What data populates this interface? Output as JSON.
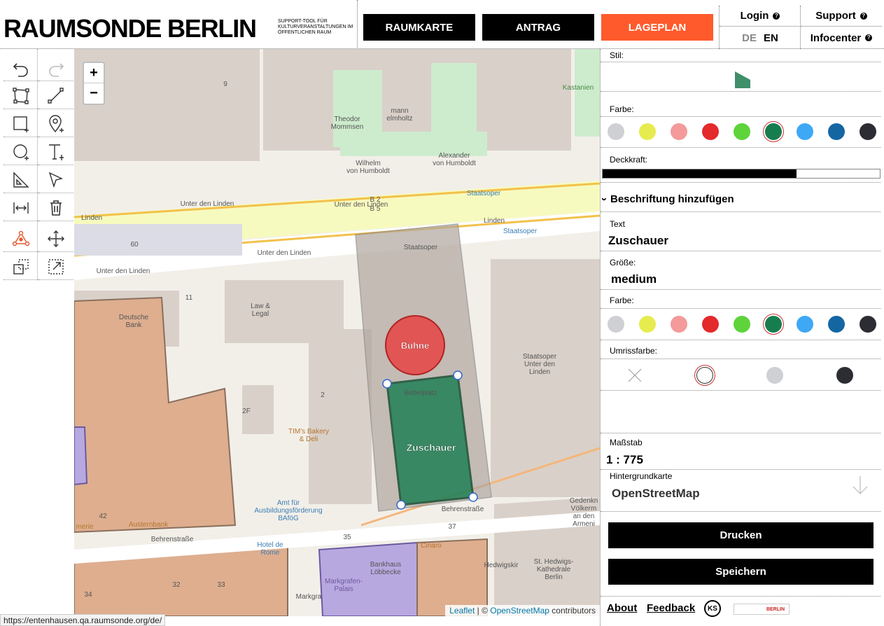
{
  "header": {
    "brand_title": "RAUMSONDE BERLIN",
    "brand_subtitle": "SUPPORT-TOOL FÜR KULTURVERANSTALTUNGEN IM ÖFFENTLICHEN RAUM",
    "nav": [
      {
        "label": "RAUMKARTE",
        "color": "#000000"
      },
      {
        "label": "ANTRAG",
        "color": "#000000"
      },
      {
        "label": "LAGEPLAN",
        "color": "#ff5a2c"
      }
    ],
    "login_label": "Login",
    "support_label": "Support",
    "lang_de": "DE",
    "lang_en": "EN",
    "infocenter_label": "Infocenter",
    "help_glyph": "?"
  },
  "toolbar": {
    "tools": [
      "undo-icon",
      "redo-icon",
      "polygon-icon",
      "line-icon",
      "rectangle-icon",
      "marker-icon",
      "circle-icon",
      "text-icon",
      "measure-icon",
      "select-icon",
      "dimension-icon",
      "trash-icon",
      "vertex-edit-icon",
      "move-icon",
      "duplicate-icon",
      "scale-icon"
    ]
  },
  "map": {
    "zoom_in": "+",
    "zoom_out": "−",
    "labels": {
      "unter_den_linden": "Unter den Linden",
      "linden": "Linden",
      "b2": "B 2",
      "b5": "B 5",
      "staatsoper": "Staatsoper",
      "staatsoper2": "Staatsoper",
      "staatsoper_top": "Staatsoper",
      "theodor": "Theodor",
      "mommsen": "Mommsen",
      "mann": "mann",
      "helmholtz": "elmholtz",
      "wilhelm": "Wilhelm",
      "von_humboldt1": "von Humboldt",
      "alexander": "Alexander",
      "von_humboldt2": "von Humboldt",
      "kastanien": "Kastanien",
      "law": "Law &",
      "legal": "Legal",
      "deutsche": "Deutsche",
      "bank": "Bank",
      "staatsoper_udl1": "Staatsoper",
      "staatsoper_udl2": "Unter den",
      "staatsoper_udl3": "Linden",
      "bebelplatz": "Bebelplatz",
      "tims1": "TIM's Bakery",
      "tims2": "& Deli",
      "amt1": "Amt für",
      "amt2": "Ausbildungsförderung",
      "amt3": "BAföG",
      "austernbank": "Austernbank",
      "behrenstrasse1": "Behrenstraße",
      "behrenstrasse2": "Behrenstraße",
      "hedwig1": "St. Hedwigs-",
      "hedwig2": "Kathedrale",
      "hedwig3": "Berlin",
      "gedenk1": "Gedenkn",
      "gedenk2": "Völkerm",
      "gedenk3": "an den",
      "gedenk4": "Armeni",
      "markgrafen1": "Markgrafen-",
      "markgrafen2": "Palais",
      "bankhaus1": "Bankhaus",
      "bankhaus2": "Löbbecke",
      "hotel_de": "Hotel de",
      "rome": "Rome",
      "cinaro": "Cinaro",
      "markgr_str": "Markgra",
      "hedwig_str": "Hedwigskir",
      "n9": "9",
      "n11": "11",
      "n60": "60",
      "n2": "2",
      "n2f": "2F",
      "n32": "32",
      "n33": "33",
      "n34": "34",
      "n35": "35",
      "n37": "37",
      "n42": "42",
      "merie": "merie"
    },
    "shapes": {
      "stage_label": "Bühne",
      "audience_label": "Zuschauer"
    },
    "attribution_leaflet": "Leaflet",
    "attribution_sep": " | © ",
    "attribution_osm": "OpenStreetMap",
    "attribution_tail": " contributors"
  },
  "status_url": "https://entenhausen.qa.raumsonde.org/de/",
  "sidebar": {
    "stil_label": "Stil:",
    "farbe_label": "Farbe:",
    "colors": [
      "#cfd0d4",
      "#e6ec4e",
      "#f49a9a",
      "#e42a2a",
      "#5ed33a",
      "#167d4f",
      "#3fa8f4",
      "#1466a3",
      "#2b2d33"
    ],
    "selected_color_index": 5,
    "deckkraft_label": "Deckkraft:",
    "opacity": 0.7,
    "beschriftung_label": "Beschriftung hinzufügen",
    "text_label": "Text",
    "text_value": "Zuschauer",
    "groesse_label": "Größe:",
    "groesse_value": "medium",
    "farbe2_label": "Farbe:",
    "umriss_label": "Umrissfarbe:",
    "outline_colors": [
      "none",
      "#ffffff",
      "#cfd0d4",
      "#2b2d33"
    ],
    "selected_outline_index": 1,
    "massstab_label": "Maßstab",
    "massstab_value": "1 : 775",
    "hintergrund_label": "Hintergrundkarte",
    "hintergrund_value": "OpenStreetMap",
    "drucken": "Drucken",
    "speichern": "Speichern",
    "about": "About",
    "feedback": "Feedback",
    "ks_logo": "KS",
    "berlin_logo": "BERLIN"
  }
}
